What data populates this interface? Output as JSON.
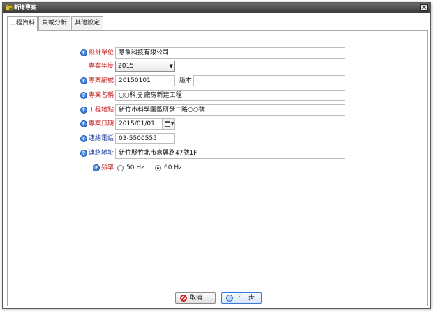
{
  "window": {
    "title": "新增專案",
    "close_label": "×",
    "icon": "folder-icon"
  },
  "tabs": [
    {
      "label": "工程資料",
      "active": true
    },
    {
      "label": "負載分析",
      "active": false
    },
    {
      "label": "其他設定",
      "active": false
    }
  ],
  "form": {
    "designer": {
      "label": "設計單位",
      "value": "意象科技有限公司"
    },
    "year": {
      "label": "專案年度",
      "value": "2015"
    },
    "number": {
      "label": "專案編號",
      "value": "20150101",
      "version_label": "版本",
      "version_value": ""
    },
    "name": {
      "label": "專案名稱",
      "value": "○○科技 廠房新建工程"
    },
    "location": {
      "label": "工程地點",
      "value": "新竹市科學園區研發二路○○號"
    },
    "date": {
      "label": "專案日期",
      "value": "2015/01/01"
    },
    "phone": {
      "label": "連絡電話",
      "value": "03-5500555"
    },
    "address": {
      "label": "連絡地址",
      "value": "新竹縣竹北市嘉興路47號1F"
    },
    "frequency": {
      "label": "頻率",
      "options": [
        "50 Hz",
        "60 Hz"
      ],
      "selected": "60 Hz"
    }
  },
  "buttons": {
    "cancel": "取消",
    "next": "下一步"
  },
  "colors": {
    "required_label": "#c41e1e",
    "optional_label": "#1b3b9a",
    "help_icon": "#1f5fc4"
  }
}
